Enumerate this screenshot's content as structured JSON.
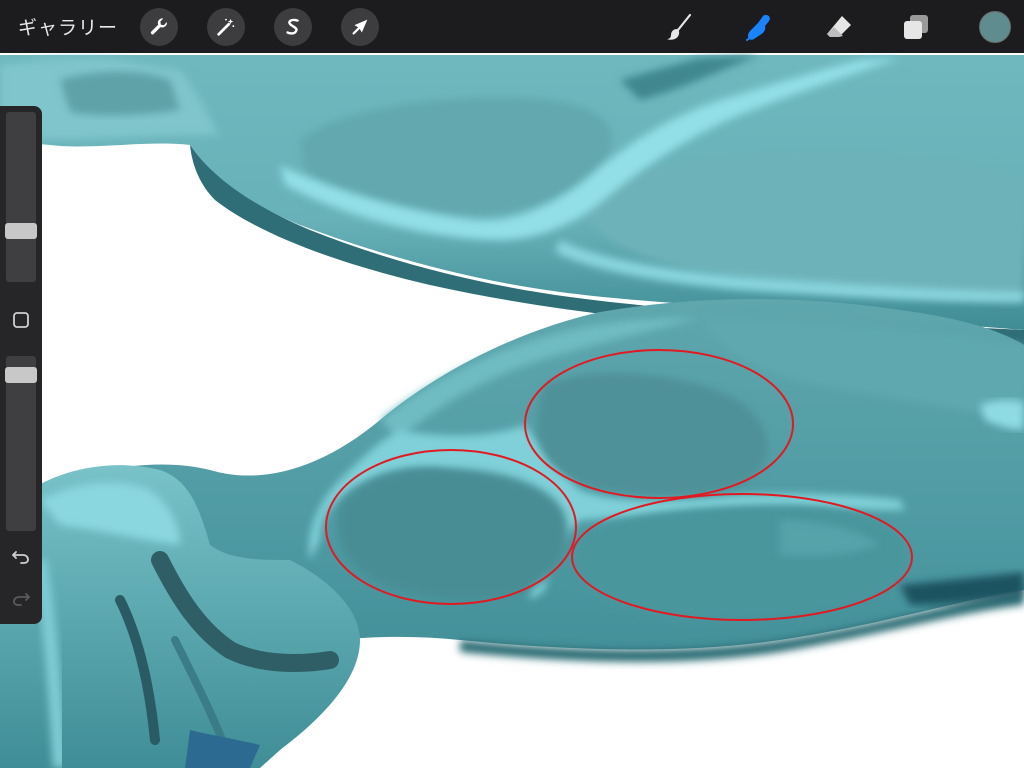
{
  "toolbar": {
    "gallery_label": "ギャラリー",
    "left_tools": [
      {
        "name": "actions",
        "icon": "wrench-icon"
      },
      {
        "name": "adjustments",
        "icon": "magic-wand-icon"
      },
      {
        "name": "selection",
        "icon": "selection-s-icon"
      },
      {
        "name": "transform",
        "icon": "arrow-cursor-icon"
      }
    ],
    "right_tools": [
      {
        "name": "brush",
        "icon": "paintbrush-icon",
        "active": false
      },
      {
        "name": "smudge",
        "icon": "smudge-finger-icon",
        "active": true
      },
      {
        "name": "eraser",
        "icon": "eraser-icon",
        "active": false
      },
      {
        "name": "layers",
        "icon": "layers-icon",
        "active": false
      }
    ],
    "current_color": "#5f8d8f",
    "active_color": "#1a84ff"
  },
  "sidebar": {
    "brush_size": 0.28,
    "opacity": 0.93,
    "modify_button_icon": "square-icon",
    "undo_icon": "undo-icon",
    "redo_icon": "redo-icon"
  },
  "artwork": {
    "palette": [
      "#5fa7ad",
      "#8fdde6",
      "#3d8f96",
      "#2a6f77",
      "#4d9ea6",
      "#2a5a63"
    ],
    "annotation_color": "#e11a22",
    "annotation_count": 3
  }
}
